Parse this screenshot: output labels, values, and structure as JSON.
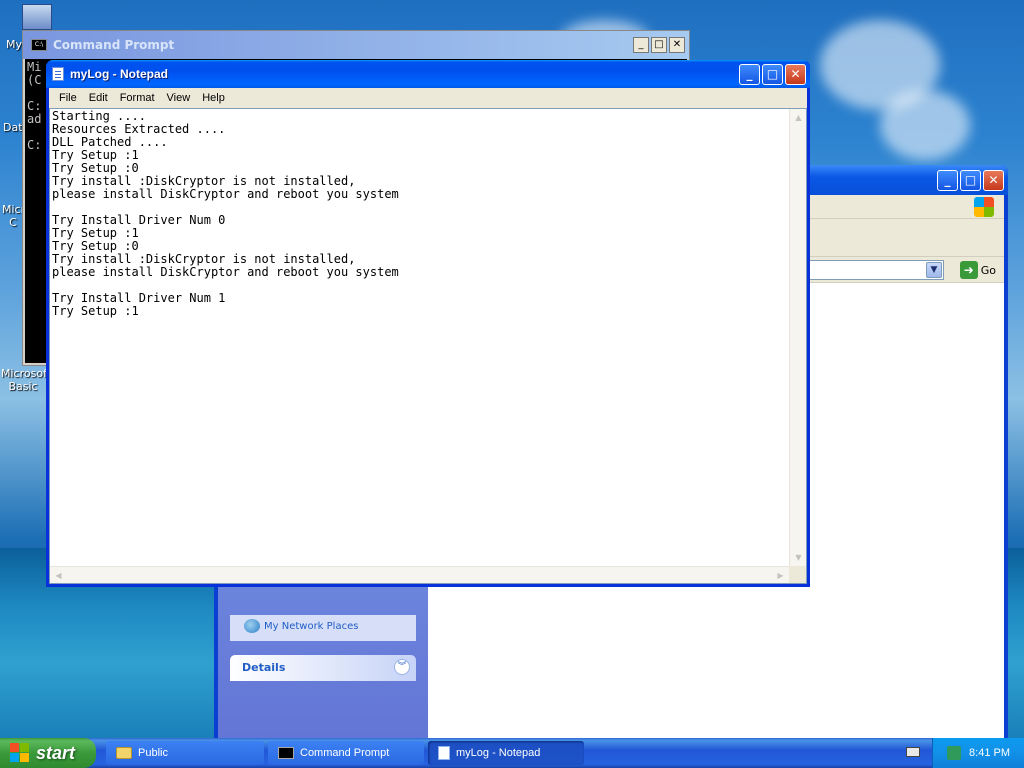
{
  "desktop": {
    "icons": [
      "My",
      "Data",
      "Microsof C",
      "Microsoft Basic"
    ]
  },
  "cmd": {
    "title": "Command Prompt",
    "lines": [
      "Mi",
      "(C",
      "",
      "C:",
      "ad",
      "",
      "C:"
    ]
  },
  "notepad": {
    "title": "myLog - Notepad",
    "menu": [
      "File",
      "Edit",
      "Format",
      "View",
      "Help"
    ],
    "content": "Starting ....\nResources Extracted ....\nDLL Patched ....\nTry Setup :1\nTry Setup :0\nTry install :DiskCryptor is not installed,\nplease install DiskCryptor and reboot you system\n\nTry Install Driver Num 0\nTry Setup :1\nTry Setup :0\nTry install :DiskCryptor is not installed,\nplease install DiskCryptor and reboot you system\n\nTry Install Driver Num 1\nTry Setup :1"
  },
  "explorer": {
    "go_label": "Go",
    "network_places": "My Network Places",
    "details_label": "Details"
  },
  "taskbar": {
    "start_label": "start",
    "tasks": [
      "Public",
      "Command Prompt",
      "myLog - Notepad"
    ],
    "clock": "8:41 PM"
  }
}
